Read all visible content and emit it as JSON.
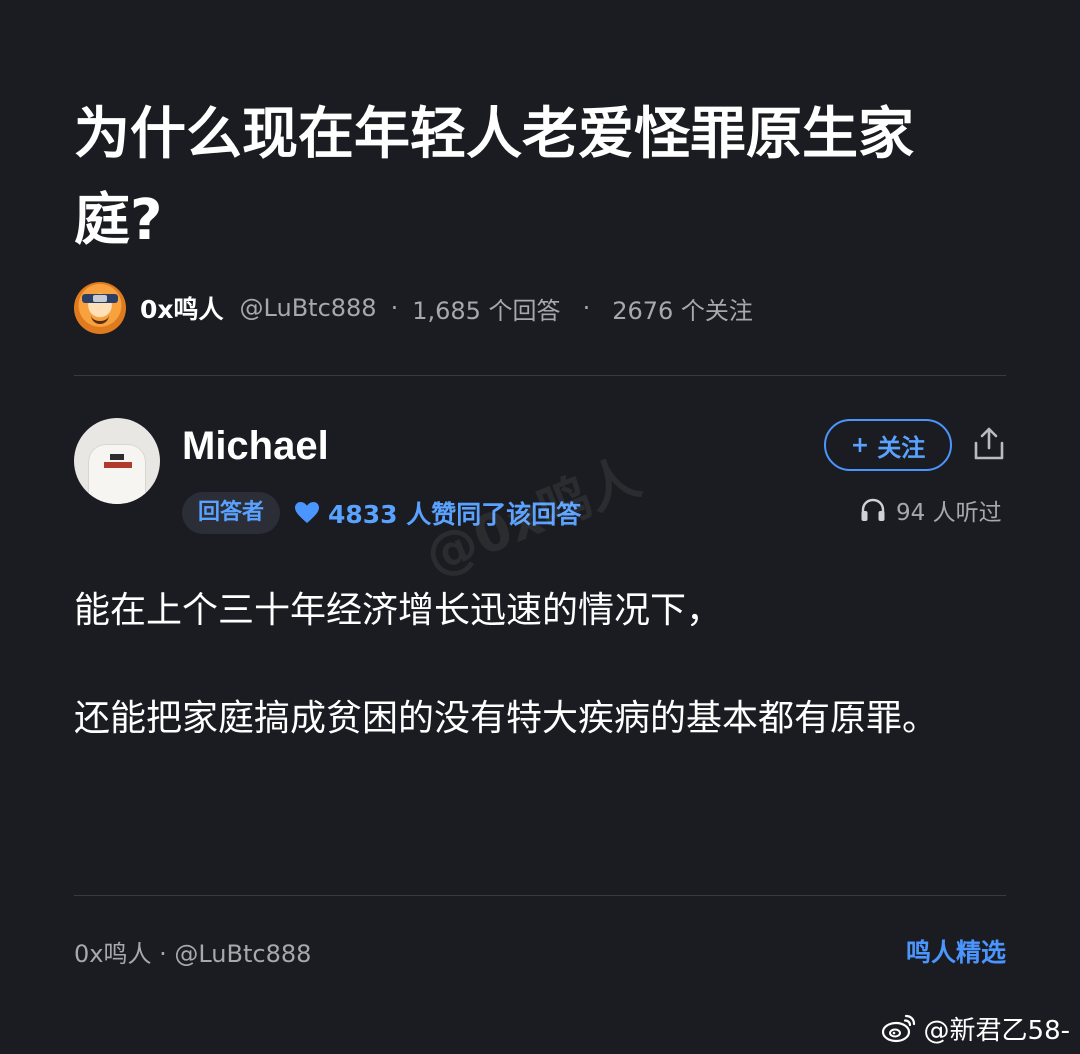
{
  "question": {
    "title": "为什么现在年轻人老爱怪罪原生家庭?"
  },
  "asker": {
    "name": "0x鸣人",
    "handle": "@LuBtc888",
    "separator": "·",
    "answers_count": "1,685 个回答",
    "follows_count": "2676 个关注",
    "avatar_icon": "naruto-avatar-icon"
  },
  "answer": {
    "author_name": "Michael",
    "role_badge": "回答者",
    "likes_text": "4833 人赞同了该回答",
    "follow_button": {
      "plus": "+",
      "label": "关注"
    },
    "listen_text": "94 人听过",
    "paragraphs": [
      "能在上个三十年经济增长迅速的情况下，",
      "还能把家庭搞成贫困的没有特大疾病的基本都有原罪。"
    ],
    "watermark": "@0x鸣人"
  },
  "footer": {
    "source": "0x鸣人 · @LuBtc888",
    "brand": "鸣人精选"
  },
  "weibo": {
    "tag": "@新君乙58-"
  },
  "colors": {
    "background": "#1b1c21",
    "accent": "#4b95ff",
    "muted_text": "#a6a8ae",
    "divider": "#393a41"
  }
}
